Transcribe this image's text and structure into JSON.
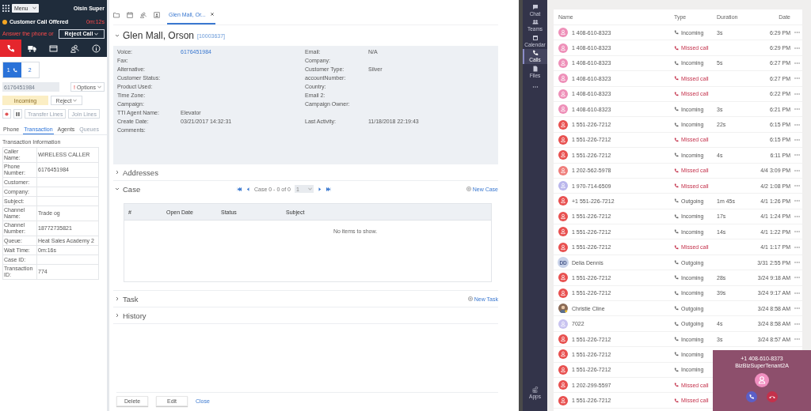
{
  "agent_bar": {
    "menu": "Menu",
    "agent": "Oisin Super",
    "status": "Customer Call Offered",
    "timer": "0m:12s",
    "prompt": "Answer the phone or",
    "reject_call": "Reject Call"
  },
  "channel_tabs": [
    {
      "kind": "phone",
      "selected": true
    },
    {
      "kind": "chat",
      "selected": false
    },
    {
      "kind": "email",
      "selected": false
    },
    {
      "kind": "social",
      "selected": false
    },
    {
      "kind": "info",
      "selected": false
    }
  ],
  "lines": [
    {
      "label": "1",
      "selected": true
    },
    {
      "label": "2",
      "selected": false
    }
  ],
  "number_field": {
    "value": "6176451984"
  },
  "options_button": {
    "alert": "!",
    "label": "Options"
  },
  "call_state": "Incoming",
  "reject_button": "Reject",
  "call_controls": [
    {
      "kind": "record"
    },
    {
      "kind": "pause"
    }
  ],
  "line_buttons": [
    {
      "label": "Transfer Lines",
      "disabled": true
    },
    {
      "label": "Join Lines",
      "disabled": true
    }
  ],
  "info_tabs": [
    {
      "label": "Phone",
      "selected": false,
      "disabled": false
    },
    {
      "label": "Transaction",
      "selected": true,
      "disabled": false
    },
    {
      "label": "Agents",
      "selected": false,
      "disabled": false
    },
    {
      "label": "Queues",
      "selected": false,
      "disabled": true
    }
  ],
  "transaction": {
    "title": "Transaction Information",
    "rows": [
      {
        "label": "Caller Name:",
        "value": "WIRELESS CALLER"
      },
      {
        "label": "Phone Number:",
        "value": "6176451984"
      },
      {
        "label": "Customer:"
      },
      {
        "label": "Company:"
      },
      {
        "label": "Subject:"
      },
      {
        "label": "Channel Name:",
        "value": "Trade og"
      },
      {
        "label": "Channel Number:",
        "value": "18772735821"
      },
      {
        "label": "Queue:",
        "value": "Heat Sales Academy 2"
      },
      {
        "label": "Wait Time:",
        "value": "0m:16s"
      },
      {
        "label": "Case ID:"
      },
      {
        "label": "Transaction ID:",
        "value": "774"
      }
    ]
  },
  "toolbar_icons": [
    {
      "kind": "folder"
    },
    {
      "kind": "calendar"
    },
    {
      "kind": "people"
    },
    {
      "kind": "contact"
    }
  ],
  "record_tab": {
    "label": "Glen Mall, Or...",
    "selected": true
  },
  "contact": {
    "name": "Glen Mall, Orson",
    "id": "[10003637]",
    "expanded": true,
    "rows": [
      {
        "left": {
          "label": "Voice:",
          "value": "6176451984",
          "link": true
        },
        "right": {
          "label": "Email:",
          "value": "N/A"
        }
      },
      {
        "left": {
          "label": "Fax:"
        },
        "right": {
          "label": "Company:"
        }
      },
      {
        "left": {
          "label": "Alternative:"
        },
        "right": {
          "label": "Customer Type:",
          "value": "Silver"
        }
      },
      {
        "left": {
          "label": "Customer Status:"
        },
        "right": {
          "label": "accountNumber:"
        }
      },
      {
        "left": {
          "label": "Product Used:"
        },
        "right": {
          "label": "Country:"
        }
      },
      {
        "left": {
          "label": "Time Zone:"
        },
        "right": {
          "label": "Email 2:"
        }
      },
      {
        "left": {
          "label": "Campaign:"
        },
        "right": {
          "label": "Campaign Owner:"
        }
      },
      {
        "left": {
          "label": "TTI Agent Name:",
          "value": "Elevator"
        }
      },
      {
        "left": {
          "label": "Create Date:",
          "value": "03/21/2017 14:32:31"
        },
        "right": {
          "label": "Last Activity:",
          "value": "11/18/2018 22:19:43"
        }
      },
      {
        "left": {
          "label": "Comments:"
        }
      }
    ]
  },
  "sections": [
    {
      "kind": "plain",
      "title": "Addresses",
      "expanded": false
    },
    {
      "kind": "case",
      "title": "Case",
      "expanded": true,
      "pager": "Case 0 - 0 of 0",
      "page": "1",
      "action": "New Case",
      "columns": [
        "#",
        "Open Date",
        "Status",
        "Subject"
      ],
      "empty": "No items to show."
    },
    {
      "kind": "plain",
      "title": "Task",
      "expanded": false,
      "action": "New Task"
    },
    {
      "kind": "plain",
      "title": "History",
      "expanded": false
    }
  ],
  "footer": {
    "buttons": [
      "Delete",
      "Edit"
    ],
    "link": "Close"
  },
  "rail": [
    {
      "kind": "chat",
      "label": "Chat",
      "selected": false
    },
    {
      "kind": "teams",
      "label": "Teams",
      "selected": false
    },
    {
      "kind": "calendar",
      "label": "Calendar",
      "selected": false
    },
    {
      "kind": "calls",
      "label": "Calls",
      "selected": true
    },
    {
      "kind": "files",
      "label": "Files",
      "selected": false
    },
    {
      "kind": "more",
      "selected": false
    },
    {
      "kind": "apps",
      "label": "Apps",
      "selected": false,
      "bottom": true
    }
  ],
  "call_history": {
    "columns": [
      "Name",
      "Type",
      "Duration",
      "Date"
    ],
    "rows": [
      {
        "name": "1 408-610-8323",
        "avatar": {
          "kind": "person",
          "color": "#ee8fb8"
        },
        "kind": "incoming",
        "type": "Incoming",
        "duration": "3s",
        "date": "6:29 PM"
      },
      {
        "name": "1 408-610-8323",
        "avatar": {
          "kind": "person",
          "color": "#ee8fb8"
        },
        "kind": "missed",
        "type": "Missed call",
        "date": "6:29 PM"
      },
      {
        "name": "1 408-610-8323",
        "avatar": {
          "kind": "person",
          "color": "#ee8fb8"
        },
        "kind": "incoming",
        "type": "Incoming",
        "duration": "5s",
        "date": "6:27 PM"
      },
      {
        "name": "1 408-610-8323",
        "avatar": {
          "kind": "person",
          "color": "#ee8fb8"
        },
        "kind": "missed",
        "type": "Missed call",
        "date": "6:27 PM"
      },
      {
        "name": "1 408-610-8323",
        "avatar": {
          "kind": "person",
          "color": "#ee8fb8"
        },
        "kind": "missed",
        "type": "Missed call",
        "date": "6:22 PM"
      },
      {
        "name": "1 408-610-8323",
        "avatar": {
          "kind": "person",
          "color": "#ee8fb8"
        },
        "kind": "incoming",
        "type": "Incoming",
        "duration": "3s",
        "date": "6:21 PM"
      },
      {
        "name": "1 551-226-7212",
        "avatar": {
          "kind": "person",
          "color": "#e8504f"
        },
        "kind": "incoming",
        "type": "Incoming",
        "duration": "22s",
        "date": "6:15 PM"
      },
      {
        "name": "1 551-226-7212",
        "avatar": {
          "kind": "person",
          "color": "#e8504f"
        },
        "kind": "missed",
        "type": "Missed call",
        "date": "6:15 PM"
      },
      {
        "name": "1 551-226-7212",
        "avatar": {
          "kind": "person",
          "color": "#e8504f"
        },
        "kind": "incoming",
        "type": "Incoming",
        "duration": "4s",
        "date": "6:11 PM"
      },
      {
        "name": "1 202-562-5978",
        "avatar": {
          "kind": "person",
          "color": "#ef7d7a"
        },
        "kind": "missed",
        "type": "Missed call",
        "date": "4/4 3:09 PM"
      },
      {
        "name": "1 970-714-6509",
        "avatar": {
          "kind": "person",
          "color": "#b9b6ec"
        },
        "kind": "missed",
        "type": "Missed call",
        "date": "4/2 1:08 PM"
      },
      {
        "name": "+1 551-226-7212",
        "avatar": {
          "kind": "person",
          "color": "#e8504f"
        },
        "kind": "outgoing",
        "type": "Outgoing",
        "duration": "1m 45s",
        "date": "4/1 1:26 PM"
      },
      {
        "name": "1 551-226-7212",
        "avatar": {
          "kind": "person",
          "color": "#e8504f"
        },
        "kind": "incoming",
        "type": "Incoming",
        "duration": "17s",
        "date": "4/1 1:24 PM"
      },
      {
        "name": "1 551-226-7212",
        "avatar": {
          "kind": "person",
          "color": "#e8504f"
        },
        "kind": "incoming",
        "type": "Incoming",
        "duration": "14s",
        "date": "4/1 1:22 PM"
      },
      {
        "name": "1 551-226-7212",
        "avatar": {
          "kind": "person",
          "color": "#e8504f"
        },
        "kind": "missed",
        "type": "Missed call",
        "date": "4/1 1:17 PM"
      },
      {
        "name": "Delia Dennis",
        "avatar": {
          "kind": "initials",
          "initials": "DD",
          "color": "#c9d3ea"
        },
        "kind": "outgoing",
        "type": "Outgoing",
        "date": "3/31 2:55 PM"
      },
      {
        "name": "1 551-226-7212",
        "avatar": {
          "kind": "person",
          "color": "#e8504f"
        },
        "kind": "incoming",
        "type": "Incoming",
        "duration": "28s",
        "date": "3/24 9:18 AM"
      },
      {
        "name": "1 551-226-7212",
        "avatar": {
          "kind": "person",
          "color": "#e8504f"
        },
        "kind": "incoming",
        "type": "Incoming",
        "duration": "39s",
        "date": "3/24 9:17 AM"
      },
      {
        "name": "Christie Cline",
        "avatar": {
          "kind": "photo"
        },
        "kind": "outgoing",
        "type": "Outgoing",
        "date": "3/24 8:58 AM"
      },
      {
        "name": "7022",
        "avatar": {
          "kind": "person",
          "color": "#c8c3f0"
        },
        "kind": "outgoing",
        "type": "Outgoing",
        "duration": "4s",
        "date": "3/24 8:58 AM"
      },
      {
        "name": "1 551-226-7212",
        "avatar": {
          "kind": "person",
          "color": "#e8504f"
        },
        "kind": "incoming",
        "type": "Incoming",
        "duration": "3s",
        "date": "3/24 8:57 AM"
      },
      {
        "name": "1 551-226-7212",
        "avatar": {
          "kind": "person",
          "color": "#e8504f"
        },
        "kind": "incoming",
        "type": "Incoming"
      },
      {
        "name": "1 551-226-7212",
        "avatar": {
          "kind": "person",
          "color": "#e8504f"
        },
        "kind": "incoming",
        "type": "Incoming"
      },
      {
        "name": "1 202-299-5597",
        "avatar": {
          "kind": "person",
          "color": "#e8504f"
        },
        "kind": "missed",
        "type": "Missed call"
      },
      {
        "name": "1 551-226-7212",
        "avatar": {
          "kind": "person",
          "color": "#e8504f"
        },
        "kind": "missed",
        "type": "Missed call"
      }
    ]
  },
  "incoming_call": {
    "number": "+1 408-610-8373",
    "caller": "BizBizSuperTenant2A",
    "color": "#f08fc0"
  }
}
